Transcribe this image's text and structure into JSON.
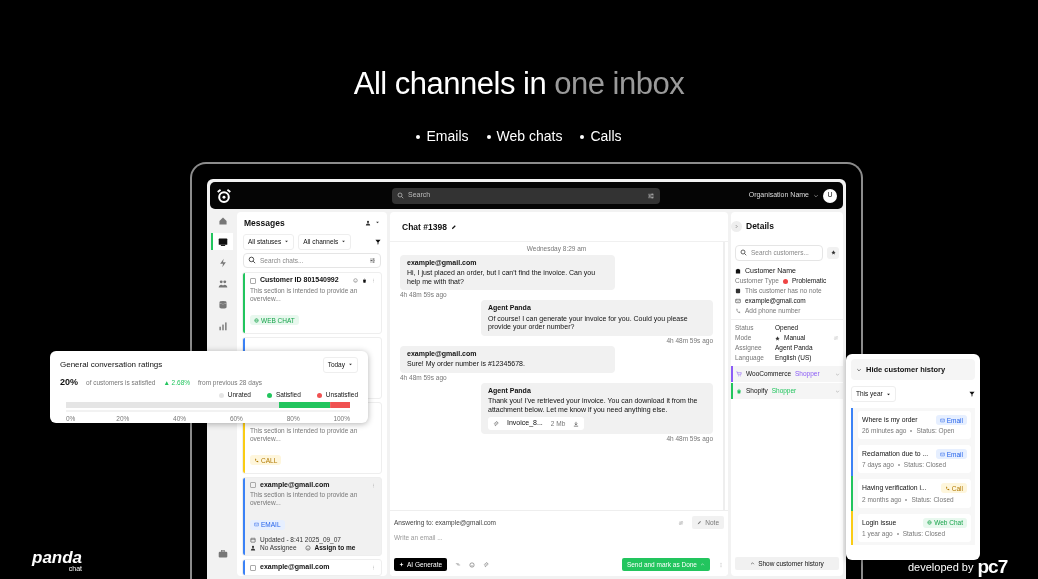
{
  "headline": [
    {
      "text": "All channels in",
      "muted": false
    },
    {
      "text": "one inbox",
      "muted": true
    }
  ],
  "channels": [
    "Emails",
    "Web chats",
    "Calls"
  ],
  "app": {
    "search_placeholder": "Search",
    "organisation": "Organisation Name",
    "avatar": "U",
    "nav": [
      {
        "kind": "home",
        "selected": false
      },
      {
        "kind": "inbox",
        "selected": true
      },
      {
        "kind": "bolt",
        "selected": false
      },
      {
        "kind": "people",
        "selected": false
      },
      {
        "kind": "database",
        "selected": false
      },
      {
        "kind": "chart",
        "selected": false
      }
    ],
    "nav_bottom": {
      "kind": "briefcase",
      "selected": false
    },
    "messages": {
      "title": "Messages",
      "filters": [
        "All statuses",
        "All channels"
      ],
      "search_placeholder": "Search chats...",
      "conversations": [
        {
          "title": "Customer ID 801540992",
          "preview": "This section is intended to provide an overview...",
          "channel": "WEB CHAT",
          "kind": "webchat",
          "color": "#22c55e",
          "selected": false
        },
        {
          "color": "#3b82f6",
          "selected": false
        },
        {
          "preview": "This section is intended to provide an overview...",
          "channel": "CALL",
          "kind": "call",
          "color": "#facc15",
          "selected": false
        },
        {
          "title": "example@gmail.com",
          "preview": "This section is intended to provide an overview...",
          "channel": "EMAIL",
          "kind": "email",
          "color": "#3b82f6",
          "selected": true,
          "updated": "Updated - 8:41 2025_09_07",
          "assignee": "No Assignee",
          "assign": "Assign to me"
        },
        {
          "title": "example@gmail.com",
          "kind": "email",
          "color": "#3b82f6",
          "selected": false
        }
      ]
    },
    "chat": {
      "title": "Chat #1398",
      "day": "Wednesday 8:29 am",
      "messages": [
        {
          "kind": "incoming",
          "sender": "example@gmail.com",
          "text": "Hi, I just placed an order, but I can't find the invoice. Can you help me with that?",
          "time": "4h 48m 59s ago"
        },
        {
          "kind": "outgoing",
          "sender": "Agent Panda",
          "text": "Of course! I can generate your invoice for you. Could you please provide your order number?",
          "time": "4h 48m 59s ago"
        },
        {
          "kind": "incoming",
          "sender": "example@gmail.com",
          "text": "Sure! My order number is #12345678.",
          "time": "4h 48m 59s ago"
        },
        {
          "kind": "outgoing",
          "sender": "Agent Panda",
          "text": "Thank you! I've retrieved your invoice. You can download it from the attachment below. Let me know if you need anything else.",
          "attachment": "Invoice_8...",
          "size": "2 Mb",
          "time": "4h 48m 59s ago"
        }
      ],
      "answering": "Answering to: example@gmail.com",
      "note": "Note",
      "placeholder": "Write an email ...",
      "ai": "AI Generate",
      "send": "Send and mark as Done"
    },
    "details": {
      "title": "Details",
      "search_placeholder": "Search customers...",
      "customer": "Customer Name",
      "customer_type": {
        "label": "Customer Type",
        "value": "Problematic",
        "color": "#ef4444"
      },
      "note": "This customer has no note",
      "email": "example@gmail.com",
      "phone_placeholder": "Add phone number",
      "fields": [
        {
          "label": "Status",
          "value": "Opened"
        },
        {
          "label": "Mode",
          "value": "Manual"
        },
        {
          "label": "Assignee",
          "value": "Agent Panda"
        },
        {
          "label": "Language",
          "value": "English (US)"
        }
      ],
      "integrations": [
        {
          "name": "WooCommerce",
          "tag": "Shopper",
          "color": "#8b5cf6",
          "kind": "woo"
        },
        {
          "name": "Shopify",
          "tag": "Shopper",
          "color": "#22c55e",
          "kind": "shopify"
        }
      ],
      "history_button": "Show customer history"
    }
  },
  "ratings": {
    "title": "General conversation ratings",
    "period": "Today",
    "percent": "20%",
    "caption": "of customers is satisfied",
    "change": "▲ 2.68%",
    "change_caption": "from previous 28 days",
    "chart_data": {
      "type": "bar",
      "orientation": "horizontal",
      "stacked": true,
      "series": [
        {
          "name": "Unrated",
          "color": "#e5e5e5",
          "values": [
            75
          ]
        },
        {
          "name": "Satisfied",
          "color": "#22c55e",
          "values": [
            18
          ]
        },
        {
          "name": "Unsatisfied",
          "color": "#f05252",
          "values": [
            7
          ]
        }
      ],
      "xlim": [
        0,
        100
      ],
      "xticks": [
        {
          "value": 0,
          "label": "0%"
        },
        {
          "value": 20,
          "label": "20%"
        },
        {
          "value": 40,
          "label": "40%"
        },
        {
          "value": 60,
          "label": "60%"
        },
        {
          "value": 80,
          "label": "80%"
        },
        {
          "value": 100,
          "label": "100%"
        }
      ]
    }
  },
  "history": {
    "title": "Hide customer history",
    "period": "This year",
    "items": [
      {
        "title": "Where is my order",
        "time": "26 minutes ago",
        "status": "Status: Open",
        "channel": "Email",
        "kind": "email",
        "color": "#3b82f6"
      },
      {
        "title": "Reclamation due to ...",
        "time": "7 days ago",
        "status": "Status: Closed",
        "channel": "Email",
        "kind": "email",
        "color": "#3b82f6"
      },
      {
        "title": "Having verification i...",
        "time": "2 months ago",
        "status": "Status: Closed",
        "channel": "Call",
        "kind": "call",
        "color": "#22c55e"
      },
      {
        "title": "Login issue",
        "time": "1 year ago",
        "status": "Status: Closed",
        "channel": "Web Chat",
        "kind": "webchat",
        "color": "#facc15"
      }
    ]
  },
  "brand": {
    "name": "panda",
    "sub": "chat",
    "developed": "developed by",
    "partner": "pc7"
  }
}
